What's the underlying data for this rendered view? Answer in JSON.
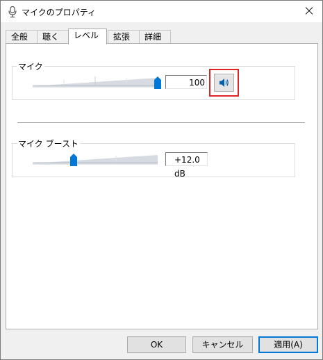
{
  "window": {
    "title": "マイクのプロパティ"
  },
  "tabs": [
    {
      "label": "全般"
    },
    {
      "label": "聴く"
    },
    {
      "label": "レベル"
    },
    {
      "label": "拡張"
    },
    {
      "label": "詳細"
    }
  ],
  "active_tab": "レベル",
  "mic": {
    "label": "マイク",
    "value": "100",
    "level_percent": 100
  },
  "boost": {
    "label": "マイク ブースト",
    "value": "+12.0 dB",
    "level_percent": 33
  },
  "buttons": {
    "ok": "OK",
    "cancel": "キャンセル",
    "apply": "適用(A)"
  },
  "colors": {
    "accent": "#0078d7",
    "highlight": "#e02424"
  }
}
